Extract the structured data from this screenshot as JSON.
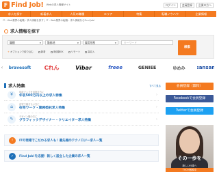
{
  "header": {
    "logo_mark": "F",
    "logo_text": "Find Job!",
    "logo_sub": "Webの求人情報サイト",
    "links": [
      "ログイン",
      "会員登録",
      "企業の方へ"
    ]
  },
  "nav": [
    "求人を探す",
    "新着求人",
    "人気の職種",
    "エリア",
    "特集",
    "転職ノウハウ",
    "企業情報"
  ],
  "breadcrumb": "IT・Web業界の転職・求人情報を探す | IT・Web業界の転職・求人情報ならFind Job!",
  "search": {
    "title": "求人情報を探す",
    "fields": [
      {
        "label": "職種"
      },
      {
        "label": "勤務地"
      },
      {
        "label": "雇用形態"
      }
    ],
    "keyword_placeholder": "キーワード",
    "button": "検索",
    "options": [
      "オプションで絞り込む",
      "新着",
      "未経験OK",
      "リモート",
      "高収入"
    ]
  },
  "logos": [
    {
      "text": "bravesoft",
      "color": "#1d6fb8"
    },
    {
      "text": "Cれん",
      "color": "#e23b3b"
    },
    {
      "text": "Vibar",
      "color": "#111111"
    },
    {
      "text": "freee",
      "color": "#2b59c3"
    },
    {
      "text": "GENIEE",
      "color": "#333333"
    },
    {
      "text": "ゆめみ",
      "color": "#555555"
    },
    {
      "text": "sansan",
      "color": "#1d4fa5"
    }
  ],
  "features": {
    "title": "求人特集",
    "more": "すべて見る",
    "items": [
      {
        "icon": "¥",
        "sub": "年収アップを目指す方に",
        "main": "年収500万円以上の求人特集",
        "color": "#1d6fb8"
      },
      {
        "icon": "⌂",
        "sub": "自宅で働きたい方に",
        "main": "在宅ワーク・業務委託求人特集",
        "color": "#1d6fb8"
      },
      {
        "icon": "✎",
        "sub": "デザイン職の方に",
        "main": "グラフィックデザイナー・クリエイター求人特集",
        "color": "#1d6fb8"
      }
    ],
    "banners": [
      {
        "icon": "!",
        "text": "ITの現場でこだわる求人も！最先端のテクノロジー求人一覧",
        "color": "#f47a20"
      },
      {
        "icon": "✓",
        "text": "Find Job!を応援！新しく設立した企業の求人一覧",
        "color": "#1d6fb8"
      }
    ]
  },
  "sidebar": {
    "register": "会員登録（無料）",
    "facebook": "Facebookで会員登録",
    "twitter": "Twitterで会員登録",
    "ad_text": "その一歩を",
    "ad_sub": "新しい仕事へ",
    "ad_strip": "TVCM放映中",
    "colors": {
      "register": "#f47a20",
      "facebook": "#3b5998",
      "twitter": "#1da1f2"
    }
  }
}
